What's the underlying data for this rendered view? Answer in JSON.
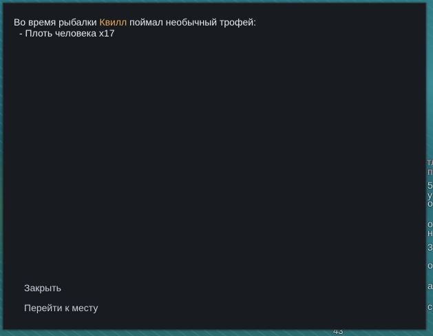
{
  "notification": {
    "message_before": "Во время рыбалки ",
    "actor": "Квилл",
    "message_after": " поймал необычный трофей:",
    "trophy_line": "- Плоть человека x17"
  },
  "actions": {
    "close_label": "Закрыть",
    "goto_label": "Перейти к месту"
  },
  "background_fragments": {
    "f1": "тл",
    "f2": "п",
    "f3": "5",
    "f4": "у",
    "f5": "о",
    "f6": "о",
    "f7": "н",
    "f8": "3",
    "f9": "о",
    "f10": "а",
    "f11": "с",
    "f12": "43"
  },
  "colors": {
    "dialog_background": "#181b20",
    "text": "#e7e8ea",
    "actor_highlight": "#e8a85a",
    "action_text": "#c9ccd6"
  }
}
